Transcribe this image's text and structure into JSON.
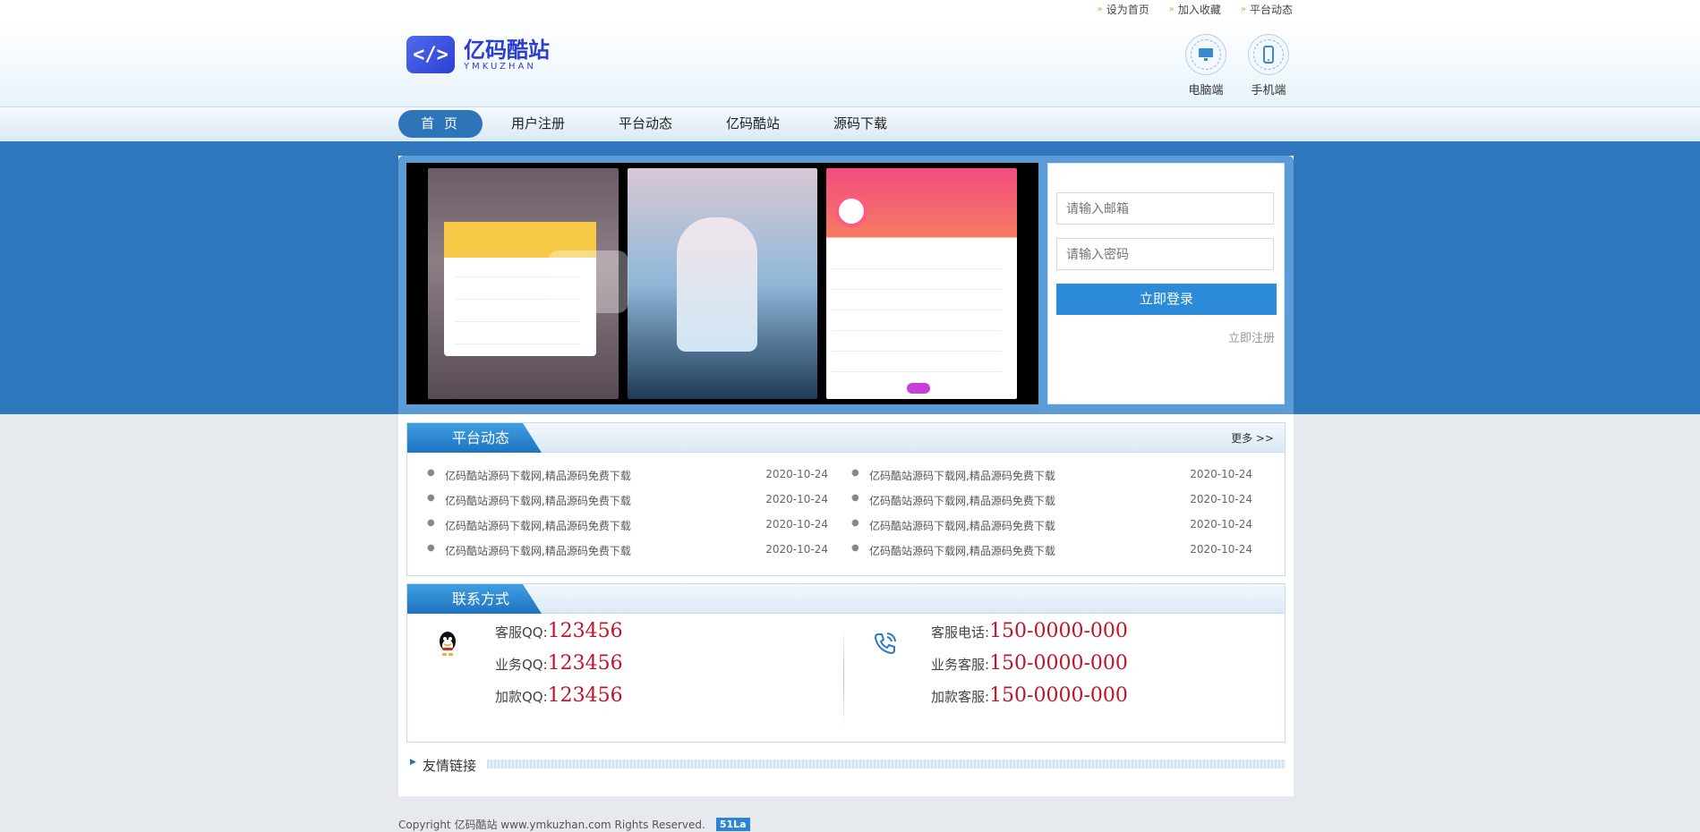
{
  "topbar": {
    "links": [
      "设为首页",
      "加入收藏",
      "平台动态"
    ]
  },
  "header": {
    "logo_mark": "</>",
    "logo_cn": "亿码酷站",
    "logo_en": "YMKUZHAN",
    "pc_label": "电脑端",
    "mobile_label": "手机端"
  },
  "nav": {
    "items": [
      "首 页",
      "用户注册",
      "平台动态",
      "亿码酷站",
      "源码下载"
    ]
  },
  "login": {
    "email_placeholder": "请输入邮箱",
    "password_placeholder": "请输入密码",
    "login_button": "立即登录",
    "register_link": "立即注册"
  },
  "news": {
    "title": "平台动态",
    "more": "更多 >>",
    "left": [
      {
        "title": "亿码酷站源码下载网,精品源码免费下载",
        "date": "2020-10-24"
      },
      {
        "title": "亿码酷站源码下载网,精品源码免费下载",
        "date": "2020-10-24"
      },
      {
        "title": "亿码酷站源码下载网,精品源码免费下载",
        "date": "2020-10-24"
      },
      {
        "title": "亿码酷站源码下载网,精品源码免费下载",
        "date": "2020-10-24"
      }
    ],
    "right": [
      {
        "title": "亿码酷站源码下载网,精品源码免费下载",
        "date": "2020-10-24"
      },
      {
        "title": "亿码酷站源码下载网,精品源码免费下载",
        "date": "2020-10-24"
      },
      {
        "title": "亿码酷站源码下载网,精品源码免费下载",
        "date": "2020-10-24"
      },
      {
        "title": "亿码酷站源码下载网,精品源码免费下载",
        "date": "2020-10-24"
      }
    ]
  },
  "contact": {
    "title": "联系方式",
    "qq": [
      {
        "label": "客服QQ:",
        "value": "123456"
      },
      {
        "label": "业务QQ:",
        "value": "123456"
      },
      {
        "label": "加款QQ:",
        "value": "123456"
      }
    ],
    "phone": [
      {
        "label": "客服电话:",
        "value": "150-0000-000"
      },
      {
        "label": "业务客服:",
        "value": "150-0000-000"
      },
      {
        "label": "加款客服:",
        "value": "150-0000-000"
      }
    ]
  },
  "links": {
    "title": "友情链接"
  },
  "footer": {
    "copyright": "Copyright 亿码酷站 www.ymkuzhan.com Rights Reserved.",
    "badge": "51La"
  },
  "colors": {
    "brand_blue": "#2f77bd",
    "accent_red": "#c0142a",
    "nav_active": "#2d74b8"
  }
}
